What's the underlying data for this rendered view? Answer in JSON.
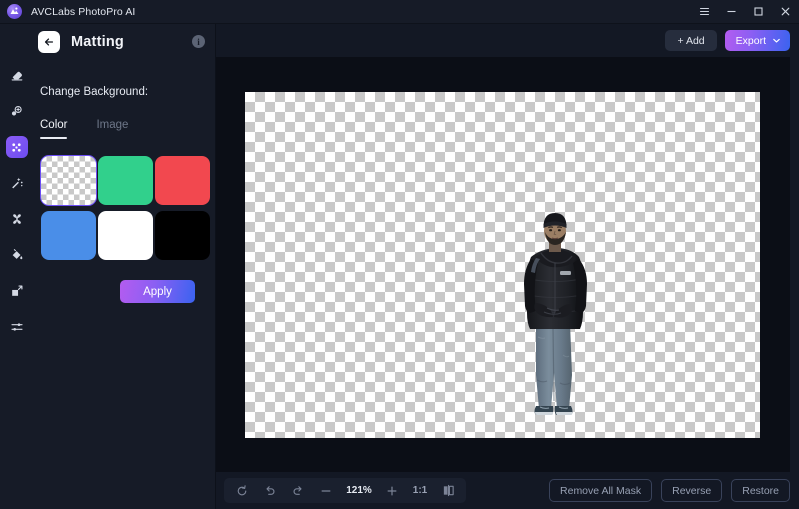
{
  "titlebar": {
    "app_name": "AVCLabs PhotoPro AI",
    "logo_icon": "avclabs-ai-logo",
    "controls": [
      {
        "name": "menu-button",
        "icon": "hamburger-menu-icon",
        "label": "☰"
      },
      {
        "name": "minimize-button",
        "icon": "minimize-icon",
        "label": "–"
      },
      {
        "name": "maximize-button",
        "icon": "maximize-icon",
        "label": "□"
      },
      {
        "name": "close-button",
        "icon": "close-icon",
        "label": "×"
      }
    ]
  },
  "rail": {
    "items": [
      {
        "name": "tool-eraser",
        "icon": "eraser-icon",
        "active": false
      },
      {
        "name": "tool-ai-retouch",
        "icon": "ai-retouch-icon",
        "active": false
      },
      {
        "name": "tool-matting",
        "icon": "matting-icon",
        "active": true
      },
      {
        "name": "tool-magic-wand",
        "icon": "magic-wand-icon",
        "active": false
      },
      {
        "name": "tool-enhance",
        "icon": "enhance-sparkle-icon",
        "active": false
      },
      {
        "name": "tool-paint-bucket",
        "icon": "paint-bucket-icon",
        "active": false
      },
      {
        "name": "tool-resize",
        "icon": "resize-expand-icon",
        "active": false
      },
      {
        "name": "tool-adjustments",
        "icon": "sliders-adjust-icon",
        "active": false
      }
    ]
  },
  "panel": {
    "back_icon": "back-arrow-icon",
    "title": "Matting",
    "info_icon": "info-icon",
    "info_glyph": "i",
    "section_label": "Change Background:",
    "tabs": [
      {
        "label": "Color",
        "active": true
      },
      {
        "label": "Image",
        "active": false
      }
    ],
    "swatches": [
      {
        "name": "swatch-transparent",
        "color": "transparent",
        "selected": true
      },
      {
        "name": "swatch-green",
        "color": "#31d08c",
        "selected": false
      },
      {
        "name": "swatch-red",
        "color": "#f2484f",
        "selected": false
      },
      {
        "name": "swatch-blue",
        "color": "#4a8ee8",
        "selected": false
      },
      {
        "name": "swatch-white",
        "color": "#ffffff",
        "selected": false
      },
      {
        "name": "swatch-black",
        "color": "#000000",
        "selected": false
      }
    ],
    "apply_label": "Apply"
  },
  "main": {
    "add_label": "+ Add",
    "export_label": "Export",
    "export_caret": "⌄",
    "canvas": {
      "background": "checkerboard-transparent",
      "subject": "person-standing-winter-jacket"
    }
  },
  "bottombar": {
    "zoom_tools": [
      {
        "name": "reset-rotate-button",
        "icon": "refresh-circle-icon",
        "label": ""
      },
      {
        "name": "undo-button",
        "icon": "undo-arrow-icon",
        "label": ""
      },
      {
        "name": "redo-button",
        "icon": "redo-arrow-icon",
        "label": ""
      },
      {
        "name": "zoom-out-button",
        "icon": "minus-icon",
        "label": ""
      }
    ],
    "zoom_level": "121%",
    "zoom_in_icon": "plus-icon",
    "fit_ratio_label": "1:1",
    "compare_icon": "split-compare-icon",
    "actions": [
      {
        "name": "remove-all-mask-button",
        "label": "Remove All Mask"
      },
      {
        "name": "reverse-button",
        "label": "Reverse"
      },
      {
        "name": "restore-button",
        "label": "Restore"
      }
    ]
  },
  "colors": {
    "accent_purple": "#8b5cf6",
    "accent_blue": "#3a63f0",
    "panel_bg": "#161b27",
    "canvas_bg": "#0b0e16",
    "app_bg": "#131824"
  }
}
